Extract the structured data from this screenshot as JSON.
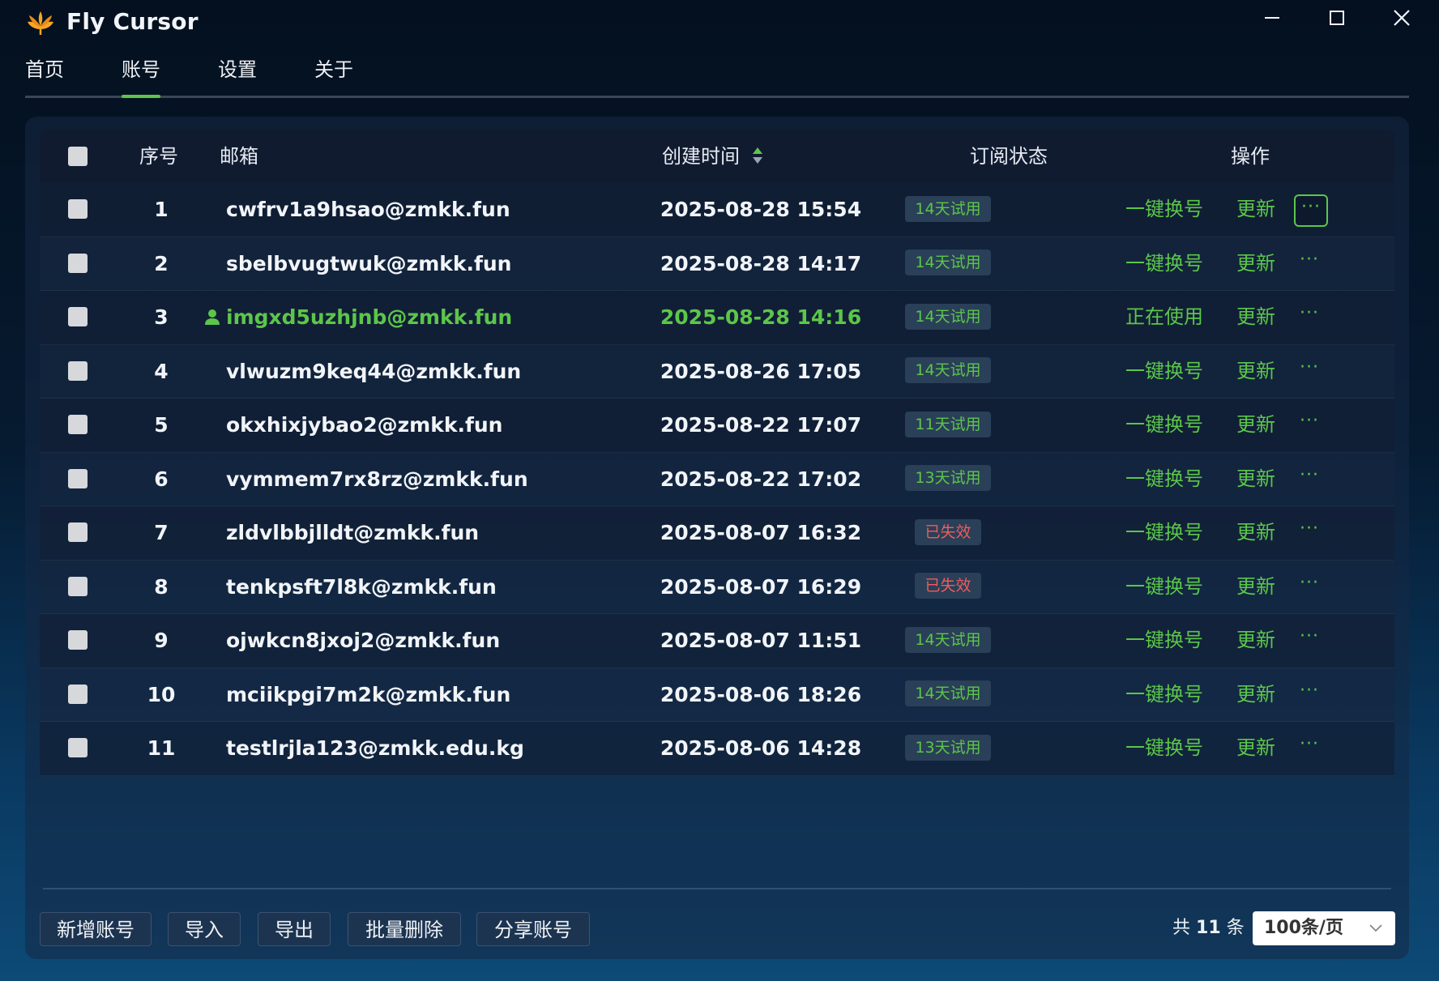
{
  "app": {
    "title": "Fly Cursor"
  },
  "nav": {
    "tabs": [
      {
        "label": "首页",
        "active": false
      },
      {
        "label": "账号",
        "active": true
      },
      {
        "label": "设置",
        "active": false
      },
      {
        "label": "关于",
        "active": false
      }
    ]
  },
  "table": {
    "headers": {
      "index": "序号",
      "email": "邮箱",
      "created": "创建时间",
      "status": "订阅状态",
      "actions": "操作"
    },
    "rows": [
      {
        "index": "1",
        "email": "cwfrv1a9hsao@zmkk.fun",
        "created": "2025-08-28 15:54",
        "status": "14天试用",
        "status_type": "trial",
        "action": "一键换号",
        "update": "更新",
        "more": "···"
      },
      {
        "index": "2",
        "email": "sbelbvugtwuk@zmkk.fun",
        "created": "2025-08-28 14:17",
        "status": "14天试用",
        "status_type": "trial",
        "action": "一键换号",
        "update": "更新",
        "more": "···"
      },
      {
        "index": "3",
        "email": "imgxd5uzhjnb@zmkk.fun",
        "created": "2025-08-28 14:16",
        "status": "14天试用",
        "status_type": "trial",
        "action": "正在使用",
        "update": "更新",
        "more": "···",
        "current": true
      },
      {
        "index": "4",
        "email": "vlwuzm9keq44@zmkk.fun",
        "created": "2025-08-26 17:05",
        "status": "14天试用",
        "status_type": "trial",
        "action": "一键换号",
        "update": "更新",
        "more": "···"
      },
      {
        "index": "5",
        "email": "okxhixjybao2@zmkk.fun",
        "created": "2025-08-22 17:07",
        "status": "11天试用",
        "status_type": "trial",
        "action": "一键换号",
        "update": "更新",
        "more": "···"
      },
      {
        "index": "6",
        "email": "vymmem7rx8rz@zmkk.fun",
        "created": "2025-08-22 17:02",
        "status": "13天试用",
        "status_type": "trial",
        "action": "一键换号",
        "update": "更新",
        "more": "···"
      },
      {
        "index": "7",
        "email": "zldvlbbjlldt@zmkk.fun",
        "created": "2025-08-07 16:32",
        "status": "已失效",
        "status_type": "expired",
        "action": "一键换号",
        "update": "更新",
        "more": "···"
      },
      {
        "index": "8",
        "email": "tenkpsft7l8k@zmkk.fun",
        "created": "2025-08-07 16:29",
        "status": "已失效",
        "status_type": "expired",
        "action": "一键换号",
        "update": "更新",
        "more": "···"
      },
      {
        "index": "9",
        "email": "ojwkcn8jxoj2@zmkk.fun",
        "created": "2025-08-07 11:51",
        "status": "14天试用",
        "status_type": "trial",
        "action": "一键换号",
        "update": "更新",
        "more": "···"
      },
      {
        "index": "10",
        "email": "mciikpgi7m2k@zmkk.fun",
        "created": "2025-08-06 18:26",
        "status": "14天试用",
        "status_type": "trial",
        "action": "一键换号",
        "update": "更新",
        "more": "···"
      },
      {
        "index": "11",
        "email": "testlrjla123@zmkk.edu.kg",
        "created": "2025-08-06 14:28",
        "status": "13天试用",
        "status_type": "trial",
        "action": "一键换号",
        "update": "更新",
        "more": "···"
      }
    ]
  },
  "footer": {
    "buttons": [
      "新增账号",
      "导入",
      "导出",
      "批量删除",
      "分享账号"
    ],
    "total_prefix": "共",
    "total_count": "11",
    "total_suffix": "条",
    "page_size": "100条/页"
  },
  "colors": {
    "accent": "#5cc64a",
    "expired": "#f05b5b",
    "badge_bg": "#2a3f58"
  }
}
